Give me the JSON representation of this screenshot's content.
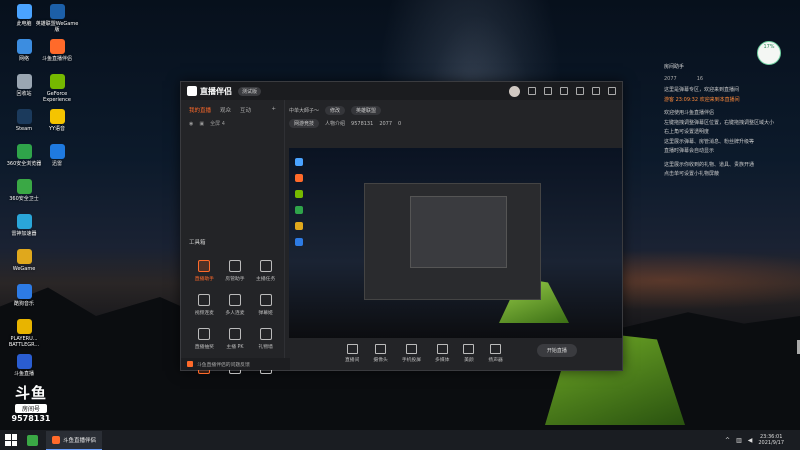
{
  "desktop": {
    "icons": [
      {
        "label": "此电脑",
        "color": "#4aa3ff",
        "x": 0,
        "y": 0
      },
      {
        "label": "英雄联盟WeGame版",
        "color": "#1c5fa8",
        "x": 1,
        "y": 0
      },
      {
        "label": "网络",
        "color": "#3c8de0",
        "x": 0,
        "y": 1
      },
      {
        "label": "斗鱼直播伴侣",
        "color": "#ff6a2a",
        "x": 1,
        "y": 1
      },
      {
        "label": "回收站",
        "color": "#9aa6b2",
        "x": 0,
        "y": 2
      },
      {
        "label": "GeForce Experience",
        "color": "#76b900",
        "x": 1,
        "y": 2
      },
      {
        "label": "Steam",
        "color": "#1b3a5c",
        "x": 0,
        "y": 3
      },
      {
        "label": "YY语音",
        "color": "#f5c400",
        "x": 1,
        "y": 3
      },
      {
        "label": "360安全浏览器",
        "color": "#2fa44a",
        "x": 0,
        "y": 4
      },
      {
        "label": "迅雷",
        "color": "#1f7ae0",
        "x": 1,
        "y": 4
      },
      {
        "label": "360安全卫士",
        "color": "#3aa845",
        "x": 0,
        "y": 5
      },
      {
        "label": "雷神加速器",
        "color": "#2aa6d9",
        "x": 0,
        "y": 6
      },
      {
        "label": "WeGame",
        "color": "#e0a81c",
        "x": 0,
        "y": 7
      },
      {
        "label": "酷狗音乐",
        "color": "#2d7be5",
        "x": 0,
        "y": 8
      },
      {
        "label": "PLAYERU... BATTLEGR...",
        "color": "#e8b400",
        "x": 0,
        "y": 9
      },
      {
        "label": "斗鱼直播",
        "color": "#2a5dd1",
        "x": 0,
        "y": 10
      }
    ]
  },
  "app": {
    "title": "直播伴侣",
    "version": "测试版",
    "left_tabs": [
      "我的直播",
      "观众",
      "互动"
    ],
    "active_tab_index": 0,
    "scene_label": "全屏 4",
    "tools_title": "工具箱",
    "tools": [
      {
        "label": "直播助手",
        "highlight": true
      },
      {
        "label": "房管助手",
        "highlight": false
      },
      {
        "label": "主播任务",
        "highlight": false
      },
      {
        "label": "视频连麦",
        "highlight": false
      },
      {
        "label": "多人连麦",
        "highlight": false
      },
      {
        "label": "弹幕姬",
        "highlight": false
      },
      {
        "label": "直播抽奖",
        "highlight": false
      },
      {
        "label": "主播 PK",
        "highlight": false
      },
      {
        "label": "礼物墙",
        "highlight": false
      },
      {
        "label": "",
        "highlight": true
      },
      {
        "label": "",
        "highlight": false
      },
      {
        "label": "",
        "highlight": false
      }
    ],
    "status_text": "斗鱼直播伴侣的问题反馈",
    "room_title": "中单大師子～",
    "edit_label": "修改",
    "category": "英雄联盟",
    "game_label": "网游竞技",
    "subcat": "人物介绍",
    "room_id": "9578131",
    "followers": "2077",
    "viewers": "0",
    "bottom_buttons": [
      "直播间",
      "摄像头",
      "手机投屏",
      "多媒体",
      "美颜",
      "扬声器"
    ],
    "start_button": "开始直播"
  },
  "chat": {
    "header": "房间助手",
    "stat1": "2077",
    "stat2": "16",
    "messages": [
      {
        "text": "这里是弹幕专区，欢迎来到直播间",
        "orange": false
      },
      {
        "text": "游客 23:09:32 欢迎来到本直播间",
        "orange": true
      },
      {
        "text": "欢迎使用斗鱼直播伴侣",
        "orange": false
      },
      {
        "text": "左键拖拽调整弹幕区位置，右键拖拽调整区域大小",
        "orange": false
      },
      {
        "text": "右上角可设置透明度",
        "orange": false
      },
      {
        "text": "这里展示弹幕、房管消息、粉丝牌升级等",
        "orange": false
      },
      {
        "text": "直播时弹幕会自动显示",
        "orange": false
      },
      {
        "text": "这里展示你收到的礼物、道具、贵族开通",
        "orange": false
      },
      {
        "text": "点击单可设置小礼物屏蔽",
        "orange": false
      }
    ],
    "badge": "17%"
  },
  "brand_overlay": {
    "word": "斗鱼",
    "room_label": "房间号",
    "room_number": "9578131"
  },
  "taskbar": {
    "app_label": "斗鱼直播伴侣",
    "time": "23:36:01",
    "date": "2021/9/17",
    "accent": "#6aa0ff"
  }
}
